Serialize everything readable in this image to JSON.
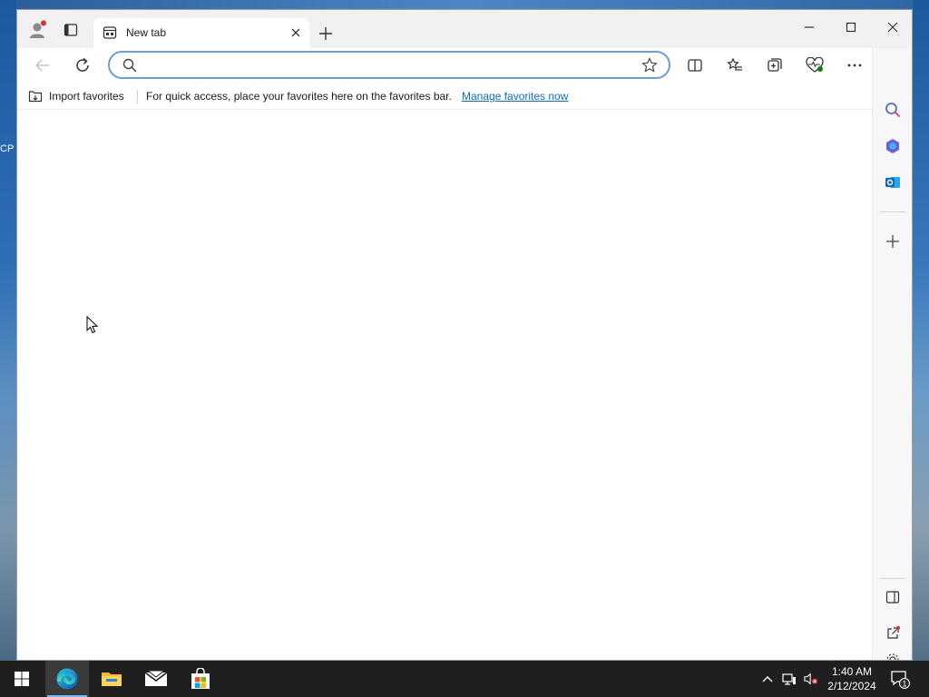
{
  "desktop": {
    "edge_fragment": "CP"
  },
  "browser": {
    "tab": {
      "title": "New tab"
    },
    "address": {
      "value": "",
      "placeholder": ""
    },
    "favorites_bar": {
      "import_label": "Import favorites",
      "message": "For quick access, place your favorites here on the favorites bar.",
      "manage_link": "Manage favorites now"
    },
    "accent_color": "#0f6cbd"
  },
  "taskbar": {
    "pinned": [
      "start-icon",
      "edge-icon",
      "file-explorer-icon",
      "mail-icon",
      "store-icon"
    ],
    "clock": {
      "time": "1:40 AM",
      "date": "2/12/2024"
    },
    "notification_count": "1"
  }
}
